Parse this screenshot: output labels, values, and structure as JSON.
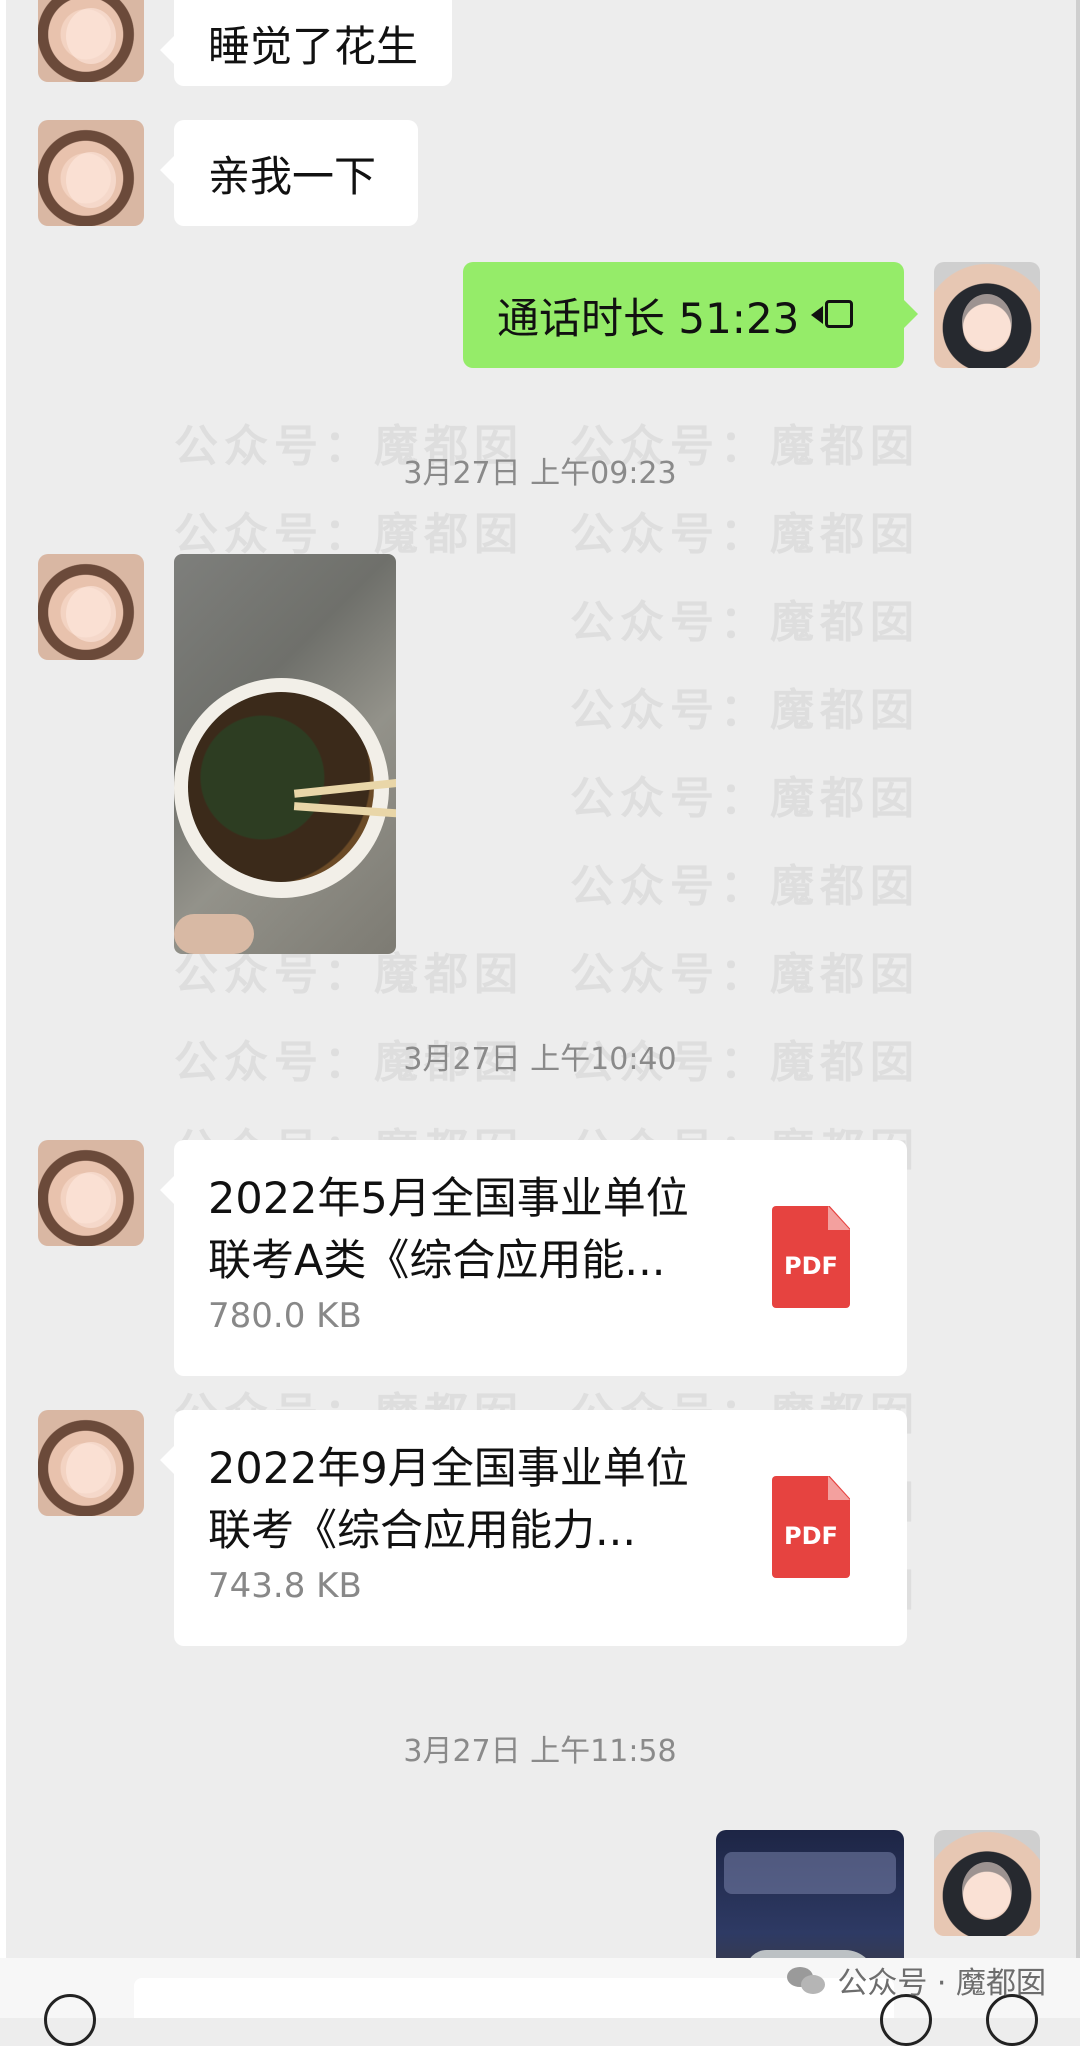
{
  "messages": {
    "msg1": "睡觉了花生",
    "msg2": "亲我一下",
    "call": "通话时长 51:23"
  },
  "timestamps": {
    "t1": "3月27日 上午09:23",
    "t2": "3月27日 上午10:40",
    "t3": "3月27日 上午11:58"
  },
  "files": [
    {
      "name_line1": "2022年5月全国事业单位",
      "name_line2": "联考A类《综合应用能...",
      "size": "780.0 KB",
      "icon_label": "PDF"
    },
    {
      "name_line1": "2022年9月全国事业单位",
      "name_line2": "联考《综合应用能力...",
      "size": "743.8 KB",
      "icon_label": "PDF"
    }
  ],
  "watermark": {
    "text_a": "公众号：",
    "text_b": "魔都囡"
  },
  "brand": {
    "text": "公众号 · 魔都囡"
  },
  "colors": {
    "chat_bg": "#ededed",
    "green_bubble": "#95ec69",
    "pdf_red": "#e64340"
  }
}
